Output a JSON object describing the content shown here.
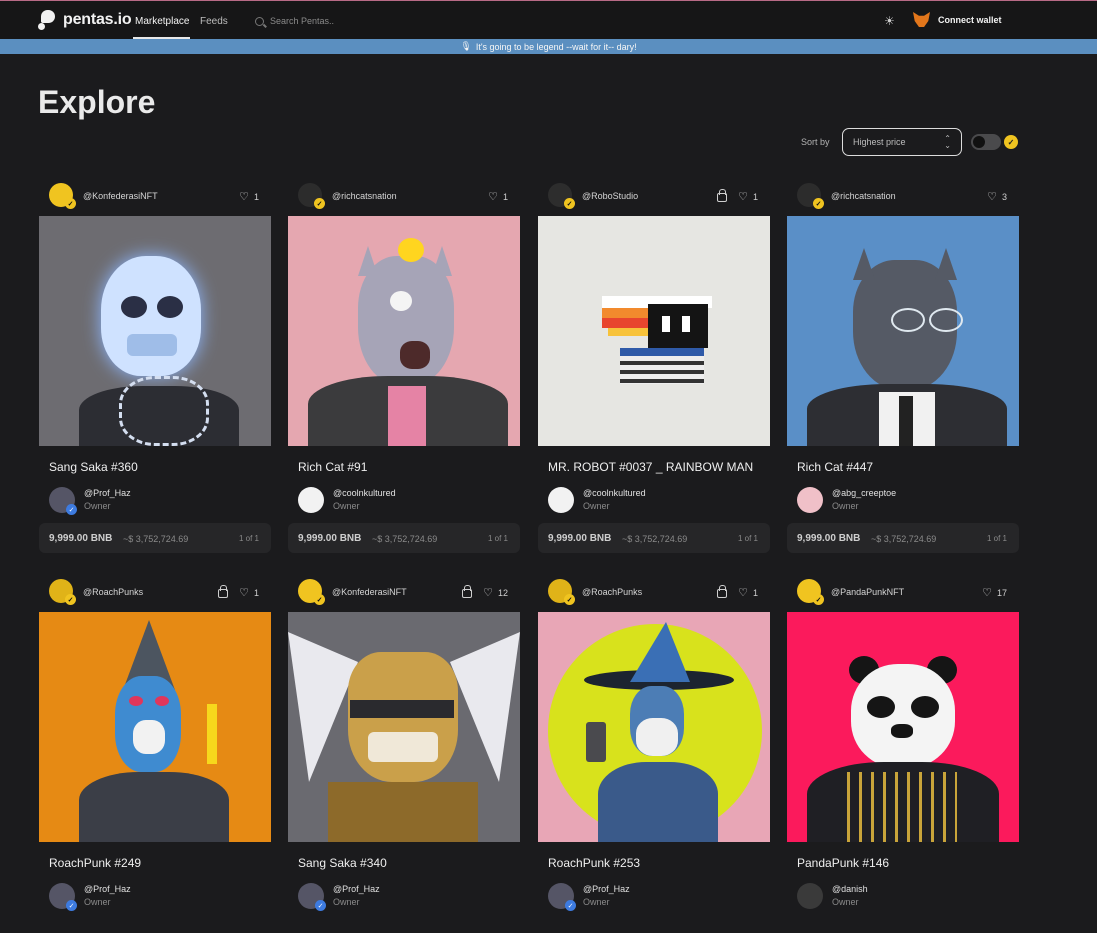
{
  "app": {
    "name": "pentas.io"
  },
  "nav": {
    "tabs": [
      "Marketplace",
      "Feeds"
    ],
    "search_placeholder": "Search Pentas..",
    "connect_label": "Connect wallet"
  },
  "banner": {
    "text": "It's going to be legend --wait for it-- dary!"
  },
  "page": {
    "title": "Explore",
    "sort_label": "Sort by",
    "sort_value": "Highest price"
  },
  "colors": {
    "banner": "#5b8fc0",
    "background": "#1b1b1d",
    "verified": "#f0c420"
  },
  "cards": [
    {
      "handle": "@KonfederasiNFT",
      "locked": false,
      "likes": "1",
      "title": "Sang Saka #360",
      "owner": "@Prof_Haz",
      "role": "Owner",
      "price": "9,999.00 BNB",
      "usd": "~$ 3,752,724.69",
      "edition": "1 of 1"
    },
    {
      "handle": "@richcatsnation",
      "locked": false,
      "likes": "1",
      "title": "Rich Cat #91",
      "owner": "@coolnkultured",
      "role": "Owner",
      "price": "9,999.00 BNB",
      "usd": "~$ 3,752,724.69",
      "edition": "1 of 1"
    },
    {
      "handle": "@RoboStudio",
      "locked": true,
      "likes": "1",
      "title": "MR. ROBOT #0037 _ RAINBOW MAN",
      "owner": "@coolnkultured",
      "role": "Owner",
      "price": "9,999.00 BNB",
      "usd": "~$ 3,752,724.69",
      "edition": "1 of 1"
    },
    {
      "handle": "@richcatsnation",
      "locked": false,
      "likes": "3",
      "title": "Rich Cat #447",
      "owner": "@abg_creeptoe",
      "role": "Owner",
      "price": "9,999.00 BNB",
      "usd": "~$ 3,752,724.69",
      "edition": "1 of 1"
    },
    {
      "handle": "@RoachPunks",
      "locked": true,
      "likes": "1",
      "title": "RoachPunk #249",
      "owner": "@Prof_Haz",
      "role": "Owner"
    },
    {
      "handle": "@KonfederasiNFT",
      "locked": true,
      "likes": "12",
      "title": "Sang Saka #340",
      "owner": "@Prof_Haz",
      "role": "Owner"
    },
    {
      "handle": "@RoachPunks",
      "locked": true,
      "likes": "1",
      "title": "RoachPunk #253",
      "owner": "@Prof_Haz",
      "role": "Owner"
    },
    {
      "handle": "@PandaPunkNFT",
      "locked": false,
      "likes": "17",
      "title": "PandaPunk #146",
      "owner": "@danish",
      "role": "Owner"
    }
  ]
}
